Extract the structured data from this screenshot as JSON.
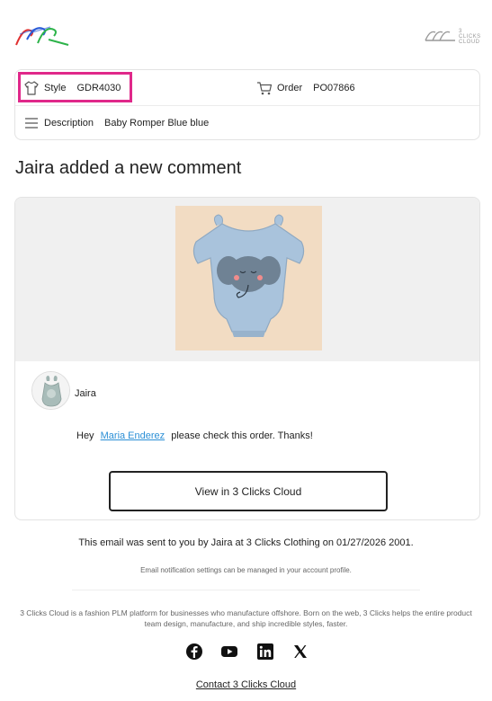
{
  "header": {
    "brand_right_line1": "3 CLICKS",
    "brand_right_line2": "CLOUD"
  },
  "details": {
    "style_label": "Style",
    "style_value": "GDR4030",
    "order_label": "Order",
    "order_value": "PO07866",
    "description_label": "Description",
    "description_value": "Baby Romper Blue blue"
  },
  "comment": {
    "title": "Jaira added a new comment",
    "author": "Jaira",
    "message_prefix": "Hey",
    "mention": "Maria Enderez",
    "message_suffix": "please check this order. Thanks!",
    "view_button": "View in 3 Clicks Cloud"
  },
  "footer": {
    "sent_note": "This email was sent to you by Jaira at 3 Clicks Clothing on 01/27/2026 2001.",
    "settings_note": "Email notification settings can be managed in your account profile.",
    "about": "3 Clicks Cloud is a fashion PLM platform for businesses who manufacture offshore. Born on the web, 3 Clicks helps the entire product team design, manufacture, and ship incredible styles, faster.",
    "contact": "Contact 3 Clicks Cloud"
  },
  "social": [
    "facebook-icon",
    "youtube-icon",
    "linkedin-icon",
    "x-icon"
  ],
  "colors": {
    "highlight": "#e0288a",
    "link": "#2b8fd6",
    "romper": "#a9c3dc",
    "image_bg": "#f2dcc3"
  }
}
